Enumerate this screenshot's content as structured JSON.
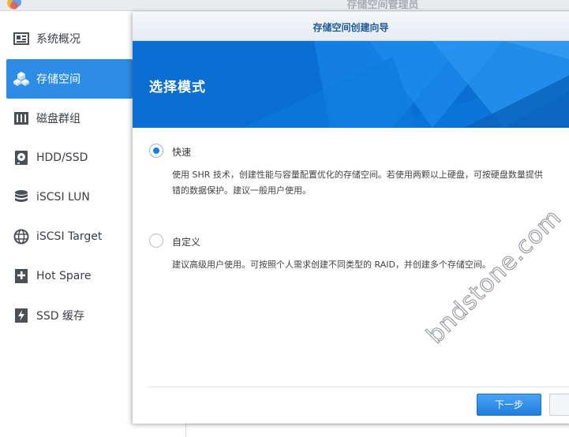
{
  "app": {
    "title": "存储空间管理员"
  },
  "sidebar": {
    "items": [
      {
        "label": "系统概况",
        "icon": "overview-icon",
        "active": false
      },
      {
        "label": "存储空间",
        "icon": "storage-cubes-icon",
        "active": true
      },
      {
        "label": "磁盘群组",
        "icon": "disk-group-icon",
        "active": false
      },
      {
        "label": "HDD/SSD",
        "icon": "hdd-icon",
        "active": false
      },
      {
        "label": "iSCSI LUN",
        "icon": "database-icon",
        "active": false
      },
      {
        "label": "iSCSI Target",
        "icon": "globe-icon",
        "active": false
      },
      {
        "label": "Hot Spare",
        "icon": "plus-box-icon",
        "active": false
      },
      {
        "label": "SSD 缓存",
        "icon": "ssd-bolt-icon",
        "active": false
      }
    ]
  },
  "wizard": {
    "title": "存储空间创建向导",
    "heading": "选择模式",
    "options": [
      {
        "label": "快速",
        "selected": true,
        "desc_line1": "使用 SHR 技术，创建性能与容量配置优化的存储空间。若使用两颗以上硬盘，可按硬盘数量提供",
        "desc_line2": "错的数据保护。建议一般用户使用。"
      },
      {
        "label": "自定义",
        "selected": false,
        "desc_line1": "建议高级用户使用。可按照个人需求创建不同类型的 RAID，并创建多个存储空间。"
      }
    ],
    "next_label": "下一步"
  },
  "watermark": "bndstone.com",
  "colors": {
    "accent": "#2d8ce5",
    "banner": "#0a73d6",
    "dialog_title": "#1f5c99"
  }
}
